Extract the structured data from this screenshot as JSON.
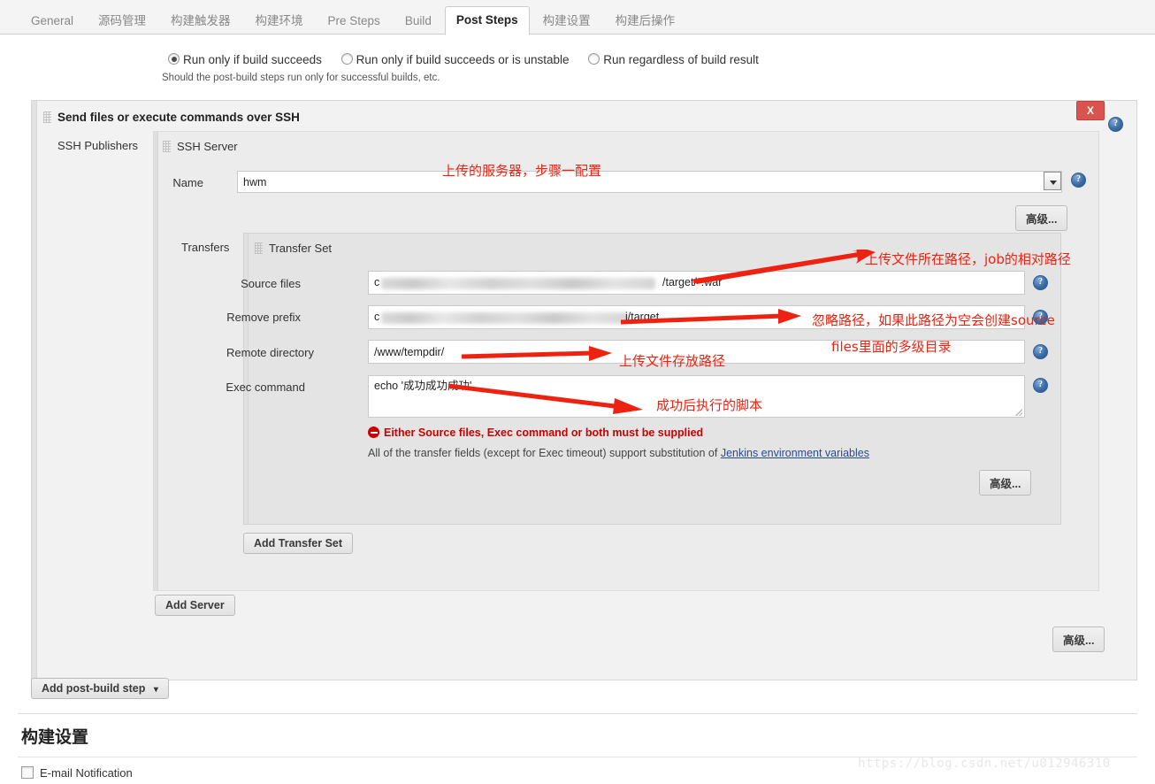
{
  "tabs": [
    {
      "label": "General",
      "active": false
    },
    {
      "label": "源码管理",
      "active": false
    },
    {
      "label": "构建触发器",
      "active": false
    },
    {
      "label": "构建环境",
      "active": false
    },
    {
      "label": "Pre Steps",
      "active": false
    },
    {
      "label": "Build",
      "active": false
    },
    {
      "label": "Post Steps",
      "active": true
    },
    {
      "label": "构建设置",
      "active": false
    },
    {
      "label": "构建后操作",
      "active": false
    }
  ],
  "run_condition": {
    "options": [
      {
        "label": "Run only if build succeeds",
        "selected": true
      },
      {
        "label": "Run only if build succeeds or is unstable",
        "selected": false
      },
      {
        "label": "Run regardless of build result",
        "selected": false
      }
    ],
    "help": "Should the post-build steps run only for successful builds, etc."
  },
  "ssh_block": {
    "title": "Send files or execute commands over SSH",
    "close_label": "X",
    "publishers_label": "SSH Publishers",
    "server": {
      "title": "SSH Server",
      "name_label": "Name",
      "name_value": "hwm",
      "advanced_label": "高级..."
    },
    "transfers": {
      "label": "Transfers",
      "set_title": "Transfer Set",
      "fields": [
        {
          "label": "Source files",
          "value": "c                   minionn/ovn minionn woh/minionn oni/target/*.war",
          "redacted": true,
          "visible_prefix": "c",
          "visible_suffix": "/target/*.war"
        },
        {
          "label": "Remove prefix",
          "value": "c                              i/target",
          "redacted": true,
          "visible_prefix": "c",
          "visible_suffix": "i/target"
        },
        {
          "label": "Remote directory",
          "value": "/www/tempdir/",
          "redacted": false
        },
        {
          "label": "Exec command",
          "value": "echo '成功成功成功'",
          "redacted": false
        }
      ],
      "error": "Either Source files, Exec command or both must be supplied",
      "note_prefix": "All of the transfer fields (except for Exec timeout) support substitution of ",
      "note_link": "Jenkins environment variables",
      "advanced_label": "高级...",
      "add_transfer_set_label": "Add Transfer Set"
    },
    "add_server_label": "Add Server",
    "advanced_label": "高级..."
  },
  "annotations": [
    {
      "text": "上传的服务器，步骤一配置"
    },
    {
      "text": "上传文件所在路径，job的相对路径"
    },
    {
      "text": "忽略路径，如果此路径为空会创建source"
    },
    {
      "text": "files里面的多级目录"
    },
    {
      "text": "上传文件存放路径"
    },
    {
      "text": "成功后执行的脚本"
    }
  ],
  "bottom": {
    "add_post_build_step_label": "Add post-build step",
    "dropdown_caret": "▾",
    "section_title": "构建设置",
    "email_notification_label": "E-mail Notification"
  },
  "watermark": "https://blog.csdn.net/u012946310",
  "colors": {
    "accent_red": "#ee2211",
    "error_red": "#cc0000",
    "close_red": "#d9534f",
    "link_blue": "#2a4b8d"
  }
}
